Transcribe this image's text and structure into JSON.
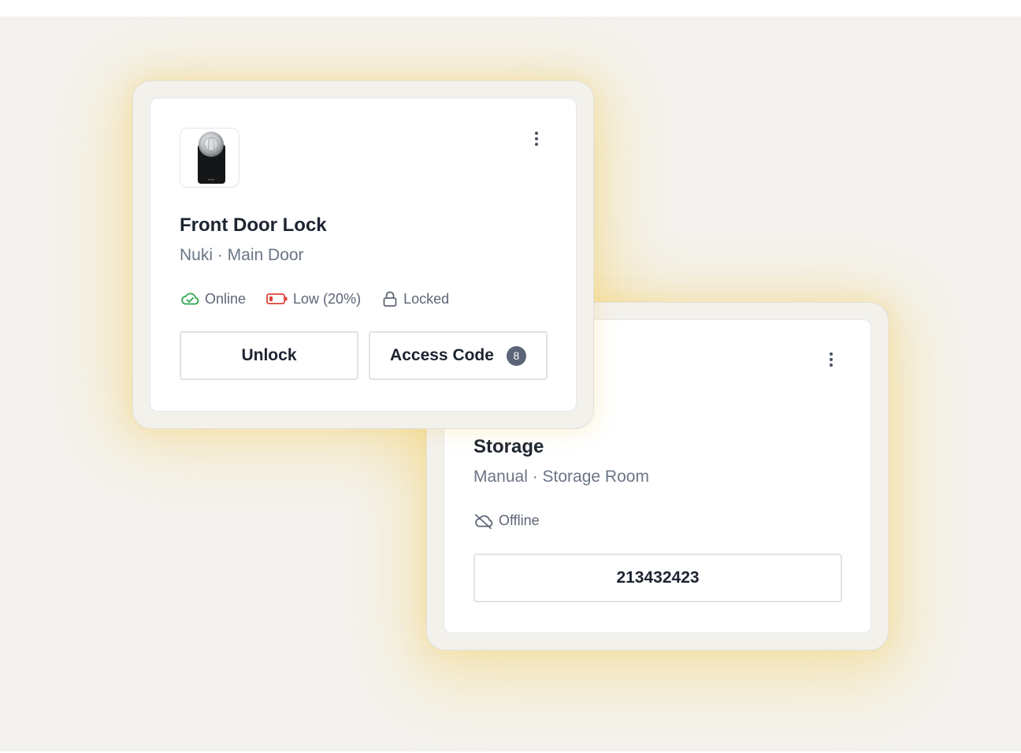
{
  "colors": {
    "background": "#f4f2ee",
    "glow": "#f6d678",
    "online": "#2eaa4e",
    "battery_low": "#e0433b",
    "muted_text": "#6b7585",
    "title_text": "#1d2430",
    "badge": "#5b6577"
  },
  "cards": [
    {
      "title": "Front Door Lock",
      "subtitle": "Nuki · Main Door",
      "image_icon": "smart-lock-device-image",
      "menu_icon": "more-vertical-icon",
      "statuses": [
        {
          "icon": "cloud-check-icon",
          "label": "Online"
        },
        {
          "icon": "battery-low-icon",
          "label": "Low (20%)"
        },
        {
          "icon": "lock-icon",
          "label": "Locked"
        }
      ],
      "buttons": {
        "unlock": "Unlock",
        "access_code": "Access Code",
        "access_code_count": "8"
      }
    },
    {
      "title": "Storage",
      "subtitle": "Manual · Storage Room",
      "menu_icon": "more-vertical-icon",
      "statuses": [
        {
          "icon": "cloud-off-icon",
          "label": "Offline"
        }
      ],
      "code": "213432423"
    }
  ]
}
